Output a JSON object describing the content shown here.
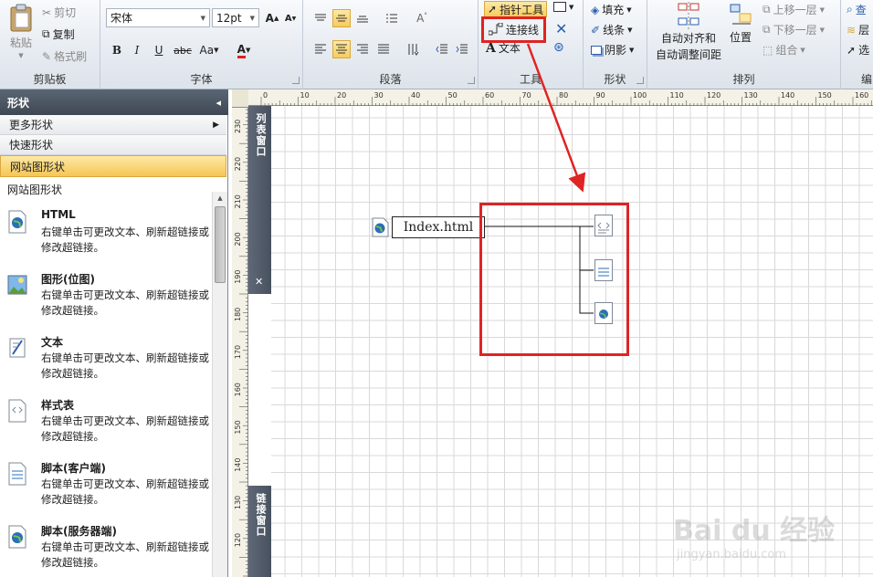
{
  "clipboard": {
    "paste": "粘贴",
    "cut": "剪切",
    "copy": "复制",
    "format_painter": "格式刷",
    "group": "剪贴板"
  },
  "font": {
    "name": "宋体",
    "size": "12pt",
    "group": "字体",
    "bold": "B",
    "italic": "I",
    "underline": "U",
    "strike": "abc",
    "case": "Aa",
    "color_letter": "A",
    "grow": "A",
    "shrink": "A"
  },
  "paragraph": {
    "group": "段落"
  },
  "tools": {
    "pointer": "指针工具",
    "connector": "连接线",
    "text": "文本",
    "group": "工具"
  },
  "shape_group": {
    "fill": "填充",
    "line": "线条",
    "shadow": "阴影",
    "group": "形状"
  },
  "arrange": {
    "auto_align_line1": "自动对齐和",
    "auto_align_line2": "自动调整间距",
    "position": "位置",
    "bring_forward": "上移一层",
    "send_backward": "下移一层",
    "group_btn": "组合",
    "group": "排列"
  },
  "editing": {
    "group": "编"
  },
  "shapes_panel": {
    "title": "形状",
    "more": "更多形状",
    "quick": "快速形状",
    "stencil": "网站图形状",
    "section_title": "网站图形状",
    "items": [
      {
        "title": "HTML",
        "desc": "右键单击可更改文本、刷新超链接或修改超链接。"
      },
      {
        "title": "图形(位图)",
        "desc": "右键单击可更改文本、刷新超链接或修改超链接。"
      },
      {
        "title": "文本",
        "desc": "右键单击可更改文本、刷新超链接或修改超链接。"
      },
      {
        "title": "样式表",
        "desc": "右键单击可更改文本、刷新超链接或修改超链接。"
      },
      {
        "title": "脚本(客户端)",
        "desc": "右键单击可更改文本、刷新超链接或修改超链接。"
      },
      {
        "title": "脚本(服务器端)",
        "desc": "右键单击可更改文本、刷新超链接或修改超链接。"
      }
    ]
  },
  "side_windows": {
    "list": "列表窗口",
    "link": "链接窗口"
  },
  "ruler": {
    "h": [
      "0",
      "10",
      "20",
      "30",
      "40",
      "50",
      "60",
      "70",
      "80",
      "90",
      "100",
      "110",
      "120",
      "130",
      "140",
      "150",
      "160"
    ],
    "v": [
      "230",
      "220",
      "210",
      "200",
      "190",
      "180",
      "170",
      "160",
      "150",
      "140",
      "130",
      "120"
    ]
  },
  "diagram": {
    "node_label": "Index.html"
  },
  "watermark": {
    "line1": "Bai du 经验",
    "line2": "jingyan.baidu.com"
  },
  "colors": {
    "highlight": "#e02323",
    "selected_button": "#f8cb5b",
    "ribbon": "#e6ebf1"
  }
}
